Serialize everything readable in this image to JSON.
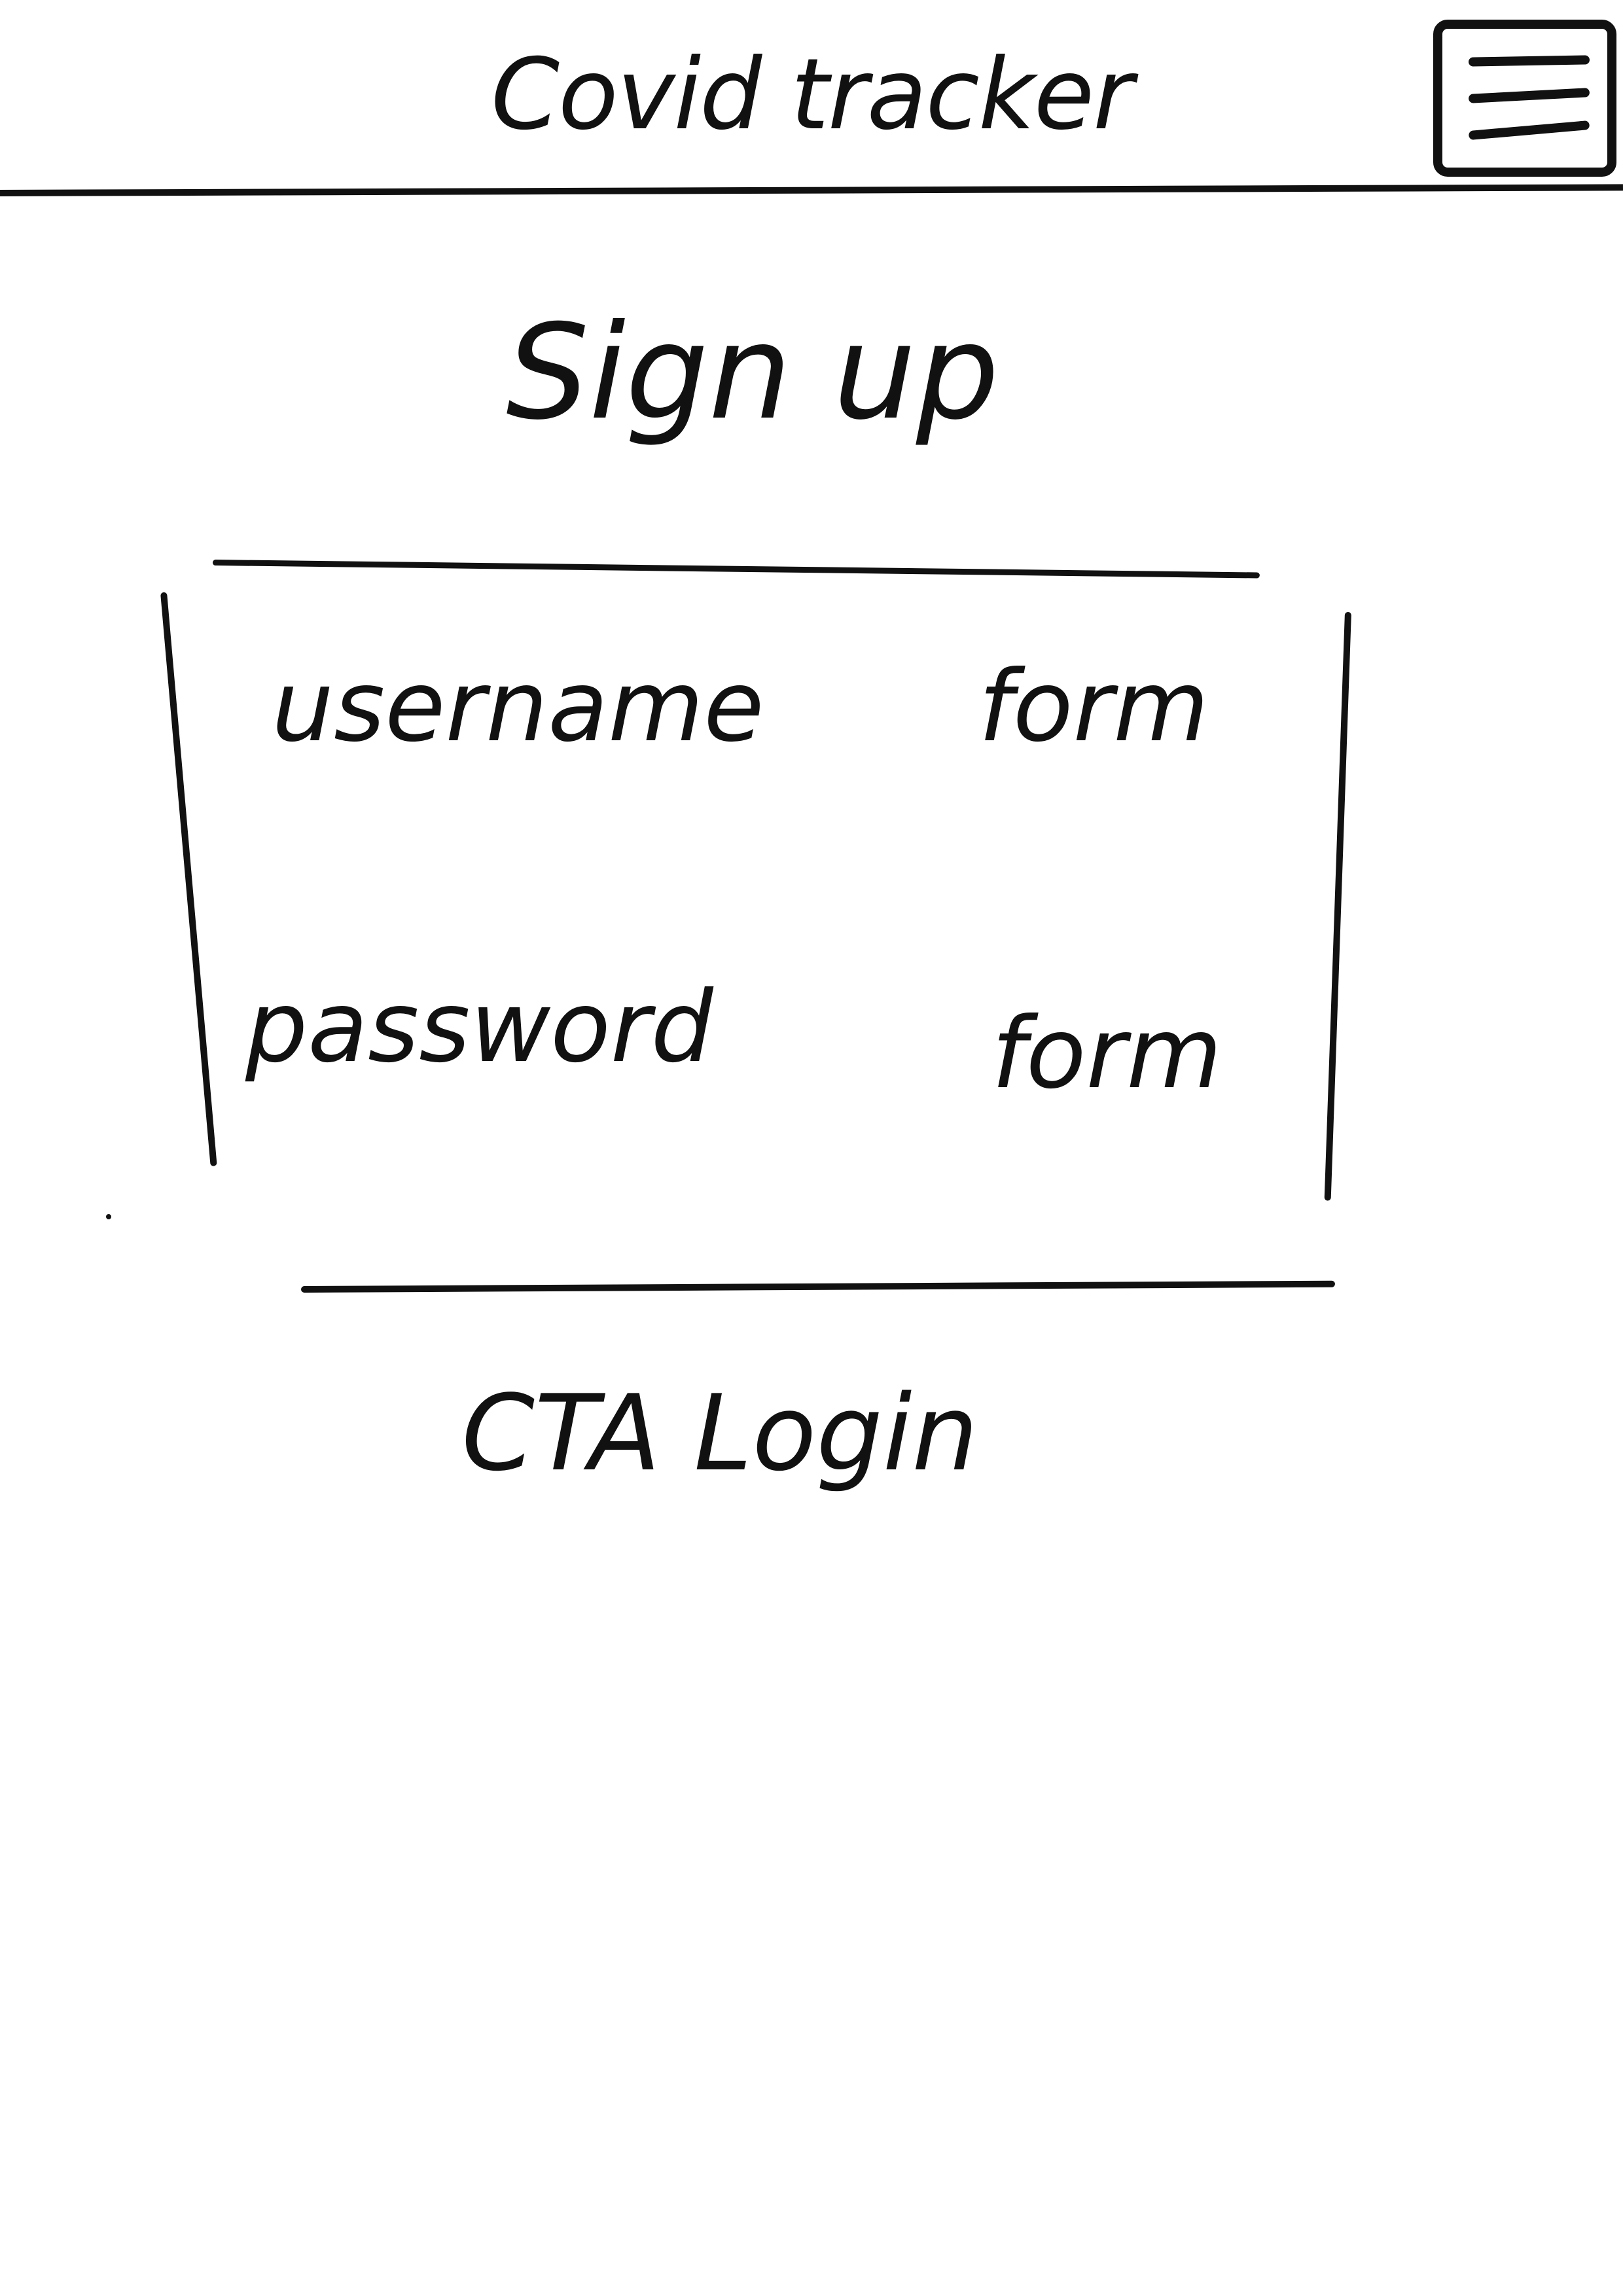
{
  "header": {
    "title": "Covid tracker",
    "menu_icon": "hamburger-menu-icon"
  },
  "page": {
    "title": "Sign up"
  },
  "form": {
    "username": {
      "label": "username",
      "placeholder": "form"
    },
    "password": {
      "label": "password",
      "placeholder": "form"
    }
  },
  "cta": {
    "label": "CTA Login"
  },
  "colors": {
    "ink": "#111111",
    "paper": "#ffffff"
  }
}
